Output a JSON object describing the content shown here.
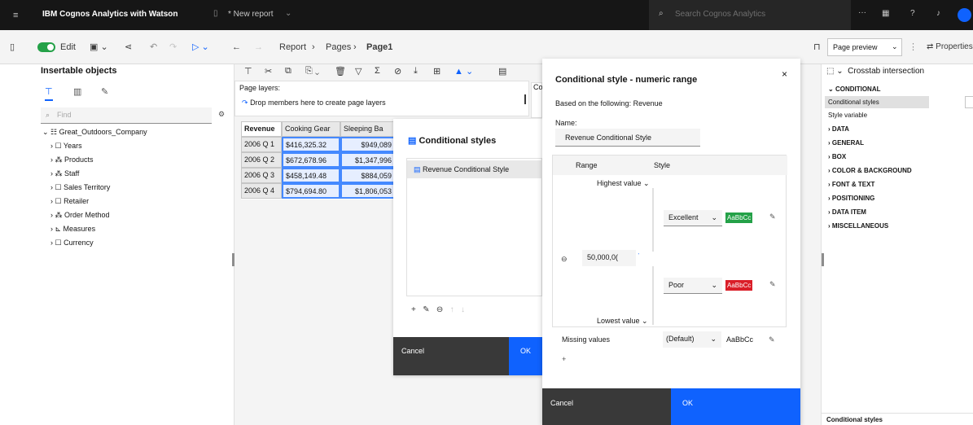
{
  "topbar": {
    "app_title": "IBM Cognos Analytics with Watson",
    "report_tab": "* New report",
    "search_placeholder": "Search Cognos Analytics"
  },
  "toolbar": {
    "edit_label": "Edit",
    "breadcrumb": [
      "Report",
      "Pages",
      "Page1"
    ],
    "page_preview_label": "Page preview",
    "properties_label": "Properties"
  },
  "left_panel": {
    "title": "Insertable objects",
    "find_placeholder": "Find",
    "tree_root": "Great_Outdoors_Company",
    "tree_items": [
      "Years",
      "Products",
      "Staff",
      "Sales Territory",
      "Retailer",
      "Order Method",
      "Measures",
      "Currency"
    ]
  },
  "center": {
    "page_layers_label": "Page layers:",
    "page_layers_hint": "Drop members here to create page layers",
    "col_header_partial": "Co",
    "table": {
      "headers": [
        "Revenue",
        "Cooking Gear",
        "Sleeping Ba"
      ],
      "rows": [
        [
          "2006 Q 1",
          "$416,325.32",
          "$949,089"
        ],
        [
          "2006 Q 2",
          "$672,678.96",
          "$1,347,996"
        ],
        [
          "2006 Q 3",
          "$458,149.48",
          "$884,059"
        ],
        [
          "2006 Q 4",
          "$794,694.80",
          "$1,806,053"
        ]
      ]
    }
  },
  "cond_styles_dialog": {
    "title": "Conditional styles",
    "item": "Revenue Conditional Style",
    "cancel": "Cancel",
    "ok": "OK"
  },
  "numeric_range_dialog": {
    "title": "Conditional style - numeric range",
    "based_on": "Based on the following: Revenue",
    "name_label": "Name:",
    "name_value": "Revenue Conditional Style",
    "col_range": "Range",
    "col_style": "Style",
    "highest_value": "Highest value",
    "threshold_value": "50,000,0(",
    "lowest_value": "Lowest value",
    "style_excellent": "Excellent",
    "style_poor": "Poor",
    "sample_text": "AaBbCc",
    "missing_values_label": "Missing values",
    "default_label": "(Default)",
    "cancel": "Cancel",
    "ok": "OK",
    "colors": {
      "excellent": "#24a148",
      "poor": "#da1e28"
    }
  },
  "right_panel": {
    "title": "Crosstab intersection",
    "conditional_section": "CONDITIONAL",
    "conditional_styles_row": "Conditional styles",
    "style_variable_row": "Style variable",
    "sections": [
      "DATA",
      "GENERAL",
      "BOX",
      "COLOR & BACKGROUND",
      "FONT & TEXT",
      "POSITIONING",
      "DATA ITEM",
      "MISCELLANEOUS"
    ],
    "footer_label": "Conditional styles"
  }
}
